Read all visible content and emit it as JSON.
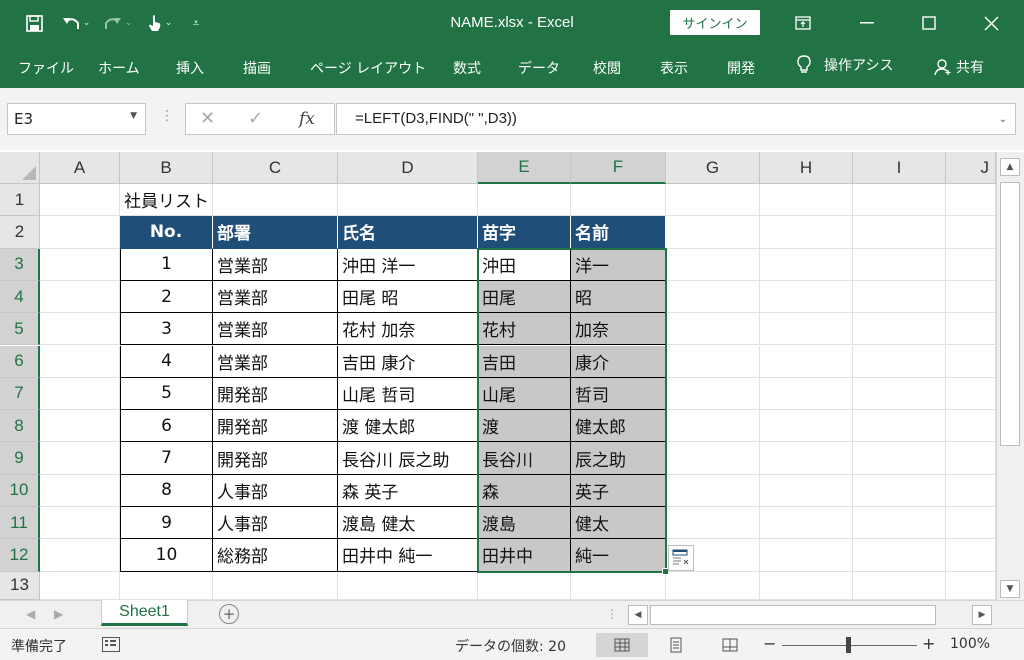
{
  "window": {
    "title": "NAME.xlsx  -  Excel",
    "signin_label": "サインイン"
  },
  "ribbon": {
    "tabs": [
      "ファイル",
      "ホーム",
      "挿入",
      "描画",
      "ページ レイアウト",
      "数式",
      "データ",
      "校閲",
      "表示",
      "開発"
    ],
    "tell_me": "操作アシス",
    "share": "共有"
  },
  "formula_bar": {
    "name_box": "E3",
    "formula": "=LEFT(D3,FIND(\" \",D3))",
    "fx_label": "fx"
  },
  "sheet": {
    "columns": [
      "A",
      "B",
      "C",
      "D",
      "E",
      "F",
      "G",
      "H",
      "I",
      "J"
    ],
    "rows": [
      "1",
      "2",
      "3",
      "4",
      "5",
      "6",
      "7",
      "8",
      "9",
      "10",
      "11",
      "12",
      "13"
    ],
    "selected_columns": [
      "E",
      "F"
    ],
    "selected_rows": [
      "3",
      "4",
      "5",
      "6",
      "7",
      "8",
      "9",
      "10",
      "11",
      "12"
    ],
    "title_cell": "社員リスト",
    "table_headers": [
      "No.",
      "部署",
      "氏名",
      "苗字",
      "名前"
    ],
    "table_rows": [
      [
        "1",
        "営業部",
        "沖田 洋一",
        "沖田",
        "洋一"
      ],
      [
        "2",
        "営業部",
        "田尾 昭",
        "田尾",
        "昭"
      ],
      [
        "3",
        "営業部",
        "花村 加奈",
        "花村",
        "加奈"
      ],
      [
        "4",
        "営業部",
        "吉田 康介",
        "吉田",
        "康介"
      ],
      [
        "5",
        "開発部",
        "山尾 哲司",
        "山尾",
        "哲司"
      ],
      [
        "6",
        "開発部",
        "渡 健太郎",
        "渡",
        "健太郎"
      ],
      [
        "7",
        "開発部",
        "長谷川 辰之助",
        "長谷川",
        "辰之助"
      ],
      [
        "8",
        "人事部",
        "森 英子",
        "森",
        "英子"
      ],
      [
        "9",
        "人事部",
        "渡島 健太",
        "渡島",
        "健太"
      ],
      [
        "10",
        "総務部",
        "田井中 純一",
        "田井中",
        "純一"
      ]
    ]
  },
  "sheet_tabs": {
    "active": "Sheet1"
  },
  "status": {
    "ready": "準備完了",
    "count": "データの個数: 20",
    "zoom": "100%"
  },
  "colors": {
    "excel_green": "#217346",
    "table_header_blue": "#1f4e78",
    "selection_gray": "#c8c8c8"
  }
}
